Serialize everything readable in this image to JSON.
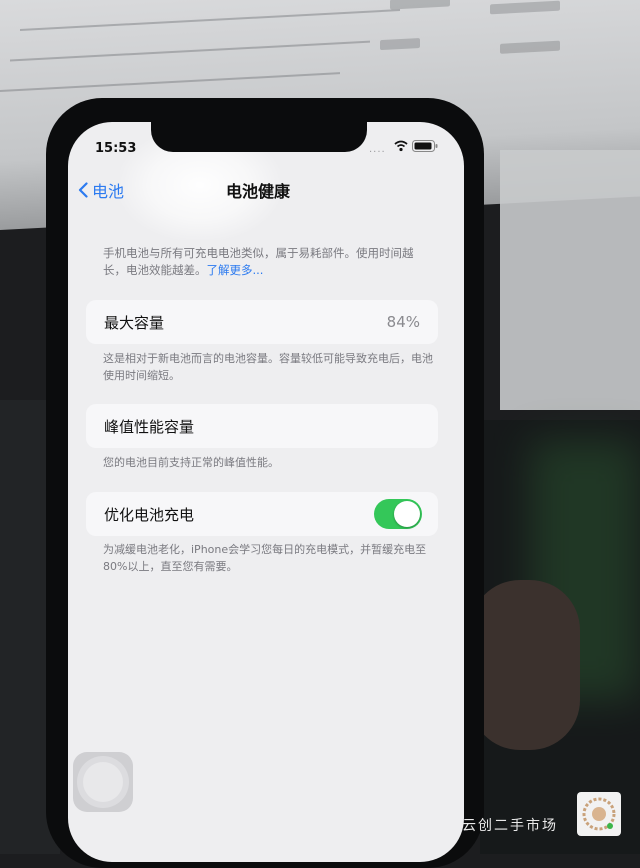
{
  "status_bar": {
    "time": "15:53",
    "signal": "...."
  },
  "nav": {
    "back_label": "电池",
    "title": "电池健康"
  },
  "intro": {
    "text": "手机电池与所有可充电电池类似，属于易耗部件。使用时间越长，电池效能越差。",
    "link": "了解更多..."
  },
  "max_capacity": {
    "label": "最大容量",
    "value": "84%",
    "note": "这是相对于新电池而言的电池容量。容量较低可能导致充电后，电池使用时间缩短。"
  },
  "peak_performance": {
    "label": "峰值性能容量",
    "note": "您的电池目前支持正常的峰值性能。"
  },
  "optimized_charging": {
    "label": "优化电池充电",
    "enabled": true,
    "note": "为减缓电池老化，iPhone会学习您每日的充电模式，并暂缓充电至80%以上，直至您有需要。"
  },
  "colors": {
    "accent": "#2b7af0",
    "toggle_on": "#34c759"
  },
  "watermark": {
    "text": "云创二手市场"
  }
}
